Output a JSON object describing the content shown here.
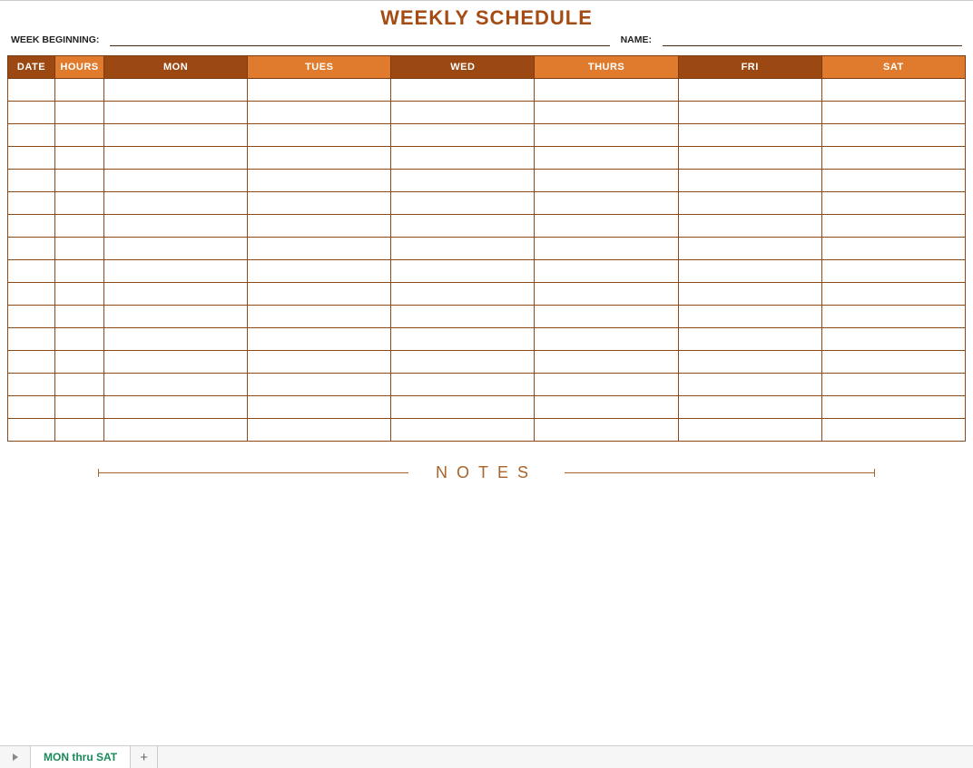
{
  "title": "WEEKLY SCHEDULE",
  "meta": {
    "week_beginning_label": "WEEK BEGINNING:",
    "week_beginning_value": "",
    "name_label": "NAME:",
    "name_value": ""
  },
  "columns": {
    "date": "DATE",
    "hours": "HOURS",
    "mon": "MON",
    "tues": "TUES",
    "wed": "WED",
    "thurs": "THURS",
    "fri": "FRI",
    "sat": "SAT"
  },
  "row_count": 16,
  "notes_label": "NOTES",
  "sheet_tab": "MON thru SAT"
}
